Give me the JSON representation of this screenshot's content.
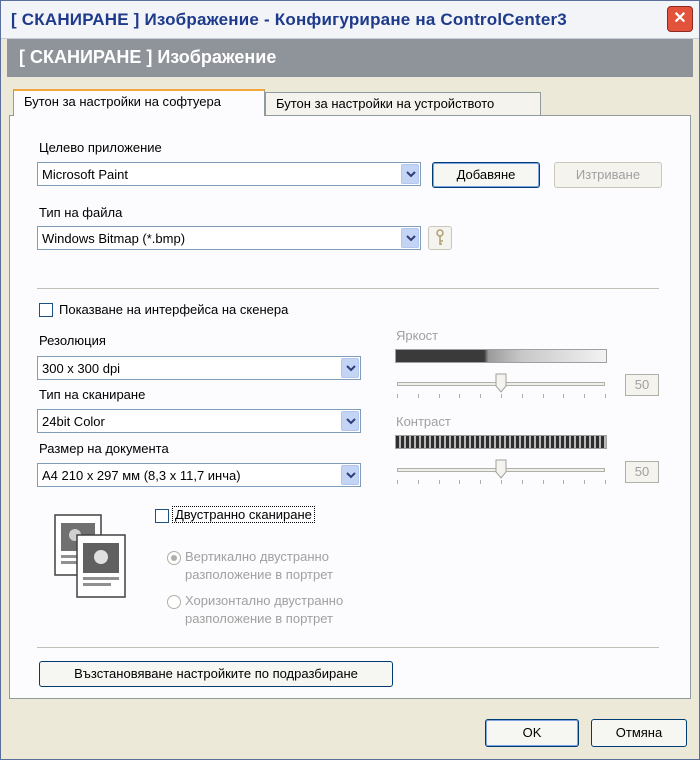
{
  "window": {
    "title": "[ СКАНИРАНЕ ] Изображение - Конфигуриране на ControlCenter3",
    "close_icon": "close-icon"
  },
  "header": {
    "title": "[ СКАНИРАНЕ ] Изображение"
  },
  "tabs": [
    {
      "label": "Бутон за настройки на софтуера",
      "active": true
    },
    {
      "label": "Бутон за настройки на устройството",
      "active": false
    }
  ],
  "target_app": {
    "label": "Целево приложение",
    "value": "Microsoft Paint",
    "add_button": "Добавяне",
    "delete_button": "Изтриване"
  },
  "file_type": {
    "label": "Тип на файла",
    "value": "Windows Bitmap (*.bmp)",
    "key_icon": "key-icon"
  },
  "show_scanner_interface": {
    "label": "Показване на интерфейса на скенера",
    "checked": false
  },
  "resolution": {
    "label": "Резолюция",
    "value": "300 x 300 dpi"
  },
  "scan_type": {
    "label": "Тип на сканиране",
    "value": "24bit Color"
  },
  "document_size": {
    "label": "Размер на документа",
    "value": "A4 210 x 297 мм (8,3 x 11,7 инча)"
  },
  "brightness": {
    "label": "Яркост",
    "value": "50",
    "level_percent": 50
  },
  "contrast": {
    "label": "Контраст",
    "value": "50",
    "level_percent": 50
  },
  "duplex": {
    "label": "Двустранно сканиране",
    "checked": false,
    "options": [
      {
        "line1": "Вертикално двустранно",
        "line2": "разположение в портрет",
        "selected": true
      },
      {
        "line1": "Хоризонтално двустранно",
        "line2": "разположение в портрет",
        "selected": false
      }
    ]
  },
  "restore_defaults_button": "Възстановяване настройките по подразбиране",
  "footer": {
    "ok_button": "OK",
    "cancel_button": "Отмяна"
  },
  "colors": {
    "title_text": "#1e3a8a",
    "header_strip": "#8f939a",
    "active_tab_accent": "#f2a83b",
    "window_bg": "#ece9d8"
  }
}
